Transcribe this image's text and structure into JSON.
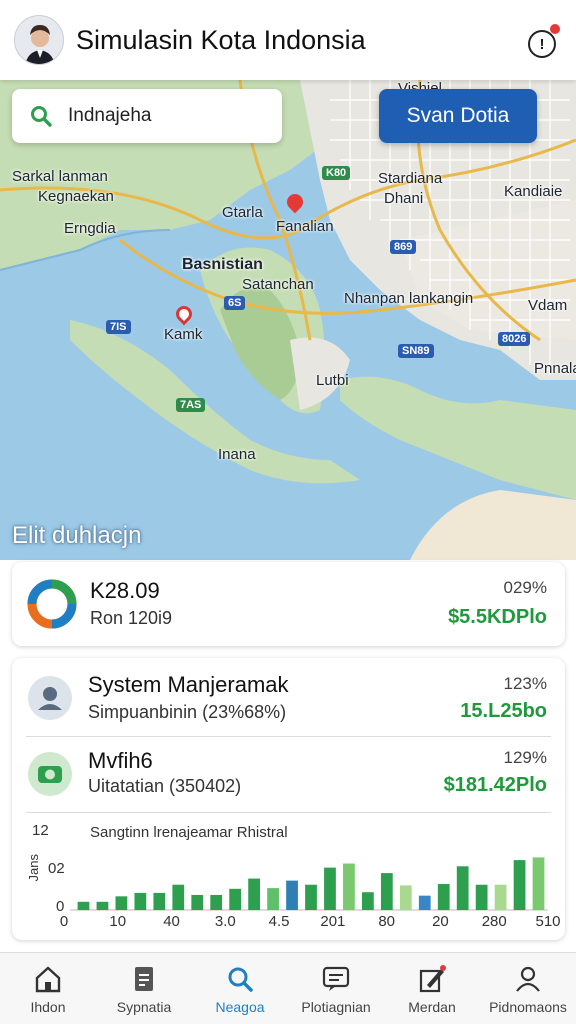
{
  "header": {
    "title": "Simulasin Kota Indonsia",
    "avatar_icon": "user-avatar",
    "info_icon": "alert-icon",
    "info_glyph": "!"
  },
  "search": {
    "value": "Indnajeha",
    "icon": "search-icon"
  },
  "save_button": {
    "label": "Svan Dotia"
  },
  "map": {
    "labels": {
      "l1": "Sarkal lanman",
      "l2": "Kegnaekan",
      "l3": "Erngdia",
      "l4": "Gtarla",
      "l5": "Fanalian",
      "l6": "Stardiana",
      "l7": "Dhani",
      "l8": "Kandiaie",
      "l9": "Basnistian",
      "l10": "Satanchan",
      "l11": "Nhanpan lankangin",
      "l12": "Vdam",
      "l13": "Kamk",
      "l14": "Lutbi",
      "l15": "Pnnalan",
      "l16": "Inana",
      "l17": "Vishiel"
    },
    "badges": {
      "b1": "K80",
      "b2": "869",
      "b3": "6S",
      "b4": "7IS",
      "b5": "SN89",
      "b6": "8026",
      "b7": "7AS"
    },
    "colors": {
      "water": "#9cc9e6",
      "land": "#c5ddb4",
      "urban": "#e8e6e0",
      "road": "#e8b84a"
    }
  },
  "section_title": "Elit duhlacjn",
  "summary_card": {
    "title": "K28.09",
    "subtitle": "Ron 120i9",
    "percent": "029%",
    "amount": "$5.5KDPlo"
  },
  "rows": [
    {
      "title": "System Manjeramak",
      "subtitle": "Simpuanbinin (23%68%)",
      "percent": "123%",
      "amount": "15.L25bo",
      "icon": "user-icon"
    },
    {
      "title": "Mvfih6",
      "subtitle": "Uitatatian (350402)",
      "percent": "129%",
      "amount": "$181.42Plo",
      "icon": "camera-icon"
    }
  ],
  "chart_data": {
    "type": "bar",
    "title": "Sangtinn lrenajeamar Rhistral",
    "y_ticks": [
      "12",
      "02",
      "0"
    ],
    "y_axis_label": "Jans",
    "x_ticks": [
      "0",
      "10",
      "40",
      "3.0",
      "4.5",
      "201",
      "80",
      "20",
      "280",
      "510"
    ],
    "ylim": [
      0,
      12
    ],
    "values": [
      1.2,
      1.2,
      2.0,
      2.5,
      2.5,
      3.7,
      2.2,
      2.2,
      3.1,
      4.6,
      3.2,
      4.3,
      3.7,
      6.2,
      6.8,
      2.6,
      5.4,
      3.6,
      2.1,
      3.8,
      6.4,
      3.7,
      3.7,
      7.3,
      7.7
    ],
    "colors": [
      "#2e9e4f",
      "#2e9e4f",
      "#2e9e4f",
      "#2e9e4f",
      "#2e9e4f",
      "#2e9e4f",
      "#2e9e4f",
      "#2e9e4f",
      "#2e9e4f",
      "#2e9e4f",
      "#5fbf6b",
      "#2f7fb5",
      "#2e9e4f",
      "#2e9e4f",
      "#7ac96e",
      "#2e9e4f",
      "#2e9e4f",
      "#a8d98e",
      "#3a86c4",
      "#2e9e4f",
      "#2e9e4f",
      "#2e9e4f",
      "#a8d98e",
      "#2e9e4f",
      "#7ac96e"
    ]
  },
  "bottom_nav": [
    {
      "label": "Ihdon",
      "icon": "home-icon"
    },
    {
      "label": "Sypnatia",
      "icon": "document-icon"
    },
    {
      "label": "Neagoa",
      "icon": "search-icon",
      "active": true
    },
    {
      "label": "Plotiagnian",
      "icon": "chat-icon"
    },
    {
      "label": "Merdan",
      "icon": "edit-icon"
    },
    {
      "label": "Pidnomaons",
      "icon": "profile-icon"
    }
  ]
}
